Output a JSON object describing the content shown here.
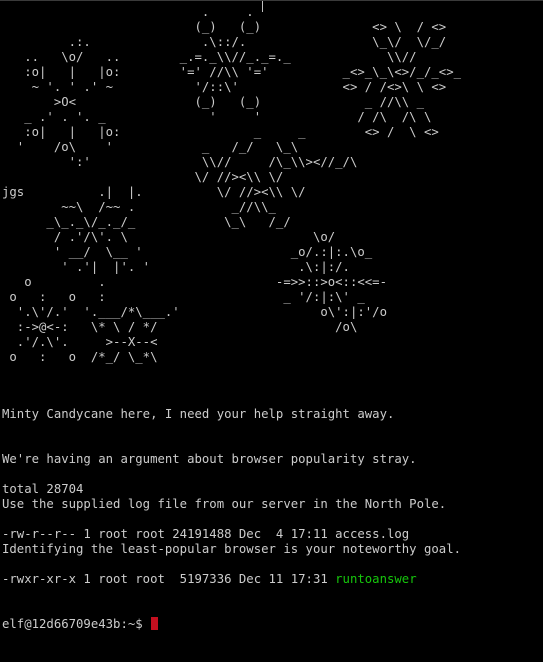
{
  "terminal": {
    "ascii_art": "                           .     .\n                          (_)   (_)               <> \\  / <>\n         .:.               .\\::/.                 \\_\\/  \\/_/\n   ..   \\o/   ..        _.=._\\\\//_._=._             \\\\//\n   :o|   |   |o:        '=' //\\\\ '='          _<>_\\_\\<>/_/_<>_\n    ~ '. ' .' ~           '/::\\'              <> / /<>\\ \\ <>\n       >O<                (_)   (_)              _ //\\\\ _\n   _ .' . '. _              '     '             / /\\  /\\ \\\n   :o|   |   |o:                  _     _        <> /  \\ <>\n  '    /o\\    '            _   /_/   \\_\\\n         ':'               \\\\//     /\\_\\\\><//_/\\\n                          \\/ //><\\\\ \\/\n       .|  |.          \\/ //><\\\\ \\/\n   ~~\\  /~~ .             _//\\\\_\n _\\_._\\/_._/_            \\_\\   /_/\n  / .'/\\'. \\                         \\o/\n  ' __/  \\__ '                    _o/.:|:.\\o_\n   ' .'|  |'. '                    .\\:|:/.\n        .                       -=>>::>o<::<<=-\n        :                        _ '/:|:\\' _\n  '.___/*\\___.'                   o\\':|:'/o\n   \\* \\ / */                        /o\\\n     >--X--<\n   /*_/ \\_*\\\n .'   \\*/   '.\n        :\n        '",
    "jgs_label": "jgs",
    "message_lines": [
      "Minty Candycane here, I need your help straight away.",
      "We're having an argument about browser popularity stray.",
      "Use the supplied log file from our server in the North Pole.",
      "Identifying the least-popular browser is your noteworthy goal."
    ],
    "listing": {
      "total_line": "total 28704",
      "files": [
        {
          "text": "-rw-r--r-- 1 root root 24191488 Dec  4 17:11 ",
          "name": "access.log"
        },
        {
          "text": "-rwxr-xr-x 1 root root  5197336 Dec 11 17:31 ",
          "name": "runtoanswer"
        }
      ]
    },
    "prompt": "elf@12d66709e43b:~$ ",
    "colors": {
      "background": "#000000",
      "text": "#cccccc",
      "executable": "#16c60c",
      "cursor": "#c50f1f"
    }
  }
}
